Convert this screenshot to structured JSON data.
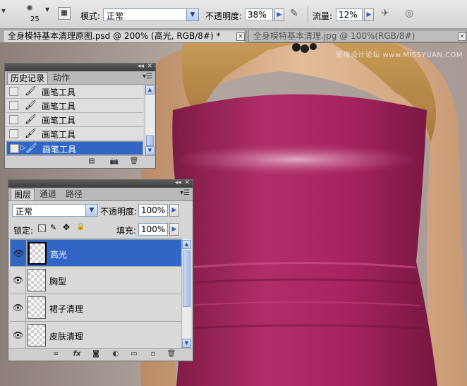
{
  "options_bar": {
    "brush_size": "25",
    "mode_label": "模式:",
    "mode_value": "正常",
    "opacity_label": "不透明度:",
    "opacity_value": "38%",
    "flow_label": "流量:",
    "flow_value": "12%"
  },
  "document_tabs": [
    {
      "title": "全身模特基本清理原图.psd @ 200% (高光, RGB/8#) *",
      "close": "✕"
    },
    {
      "title": "全身模特基本清理.jpg @ 100%(RGB/8#)",
      "close": "✕"
    }
  ],
  "watermark": "思缘设计论坛 www.MISSYUAN.COM",
  "history_panel": {
    "tabs": [
      "历史记录",
      "动作"
    ],
    "items": [
      {
        "label": "画笔工具",
        "selected": false
      },
      {
        "label": "画笔工具",
        "selected": false
      },
      {
        "label": "画笔工具",
        "selected": false
      },
      {
        "label": "画笔工具",
        "selected": false
      },
      {
        "label": "画笔工具",
        "selected": true
      }
    ]
  },
  "layers_panel": {
    "tabs": [
      "图层",
      "通道",
      "路径"
    ],
    "blend_mode": "正常",
    "opacity_label": "不透明度:",
    "opacity_value": "100%",
    "lock_label": "锁定:",
    "fill_label": "填充:",
    "fill_value": "100%",
    "layers": [
      {
        "name": "高光",
        "selected": true
      },
      {
        "name": "胸型",
        "selected": false
      },
      {
        "name": "裙子清理",
        "selected": false
      },
      {
        "name": "皮肤清理",
        "selected": false
      }
    ]
  },
  "colors": {
    "selection": "#3166c5",
    "dress": "#a8245f",
    "skin": "#d9b08a",
    "hair": "#c9a15e"
  }
}
